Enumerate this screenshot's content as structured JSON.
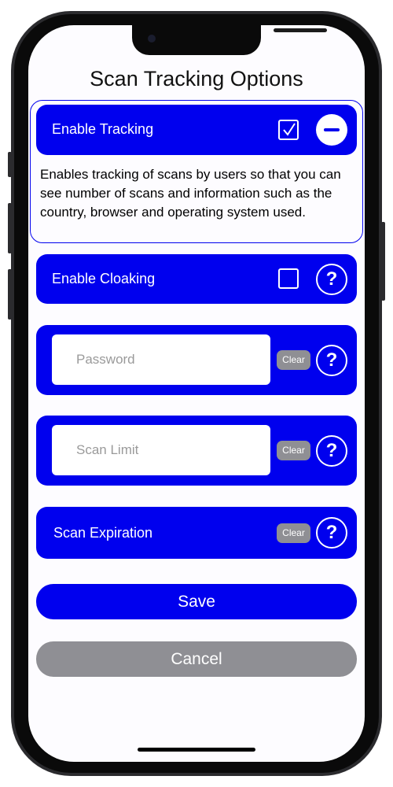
{
  "page": {
    "title": "Scan Tracking Options"
  },
  "tracking": {
    "label": "Enable Tracking",
    "checked": true,
    "toggle_icon": "minus-circle-icon",
    "description": "Enables tracking of scans by users so that you can see number of scans and information such as the country, browser and operating system used."
  },
  "cloaking": {
    "label": "Enable Cloaking",
    "checked": false,
    "help_symbol": "?"
  },
  "password": {
    "placeholder": "Password",
    "value": "",
    "clear_label": "Clear",
    "help_symbol": "?"
  },
  "scan_limit": {
    "placeholder": "Scan Limit",
    "value": "",
    "clear_label": "Clear",
    "help_symbol": "?"
  },
  "expiration": {
    "label": "Scan Expiration",
    "clear_label": "Clear",
    "help_symbol": "?"
  },
  "actions": {
    "save_label": "Save",
    "cancel_label": "Cancel"
  },
  "colors": {
    "accent": "#0000ee",
    "secondary": "#8f8f94",
    "background": "#fdfcff"
  }
}
